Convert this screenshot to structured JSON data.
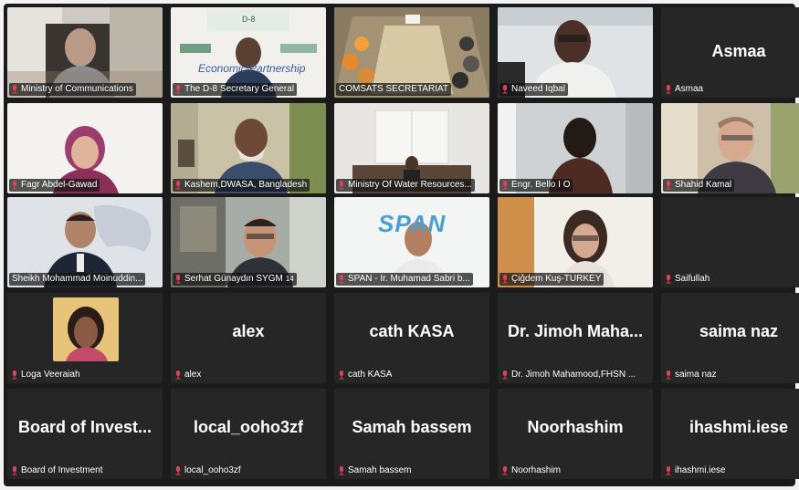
{
  "participants": [
    {
      "name": "Ministry of Communications",
      "display": "video"
    },
    {
      "name": "The D-8 Secretary General",
      "display": "video",
      "overlay": "Economic Partnership",
      "overlay_logo": "D-8"
    },
    {
      "name": "COMSATS SECRETARIAT",
      "display": "video",
      "active_speaker": true
    },
    {
      "name": "Naveed Iqbal",
      "display": "video"
    },
    {
      "name": "Asmaa",
      "display": "name_only",
      "big_label": "Asmaa"
    },
    {
      "name": "Fagr Abdel-Gawad",
      "display": "video"
    },
    {
      "name": "Kashem,DWASA, Bangladesh",
      "display": "video"
    },
    {
      "name": "Ministry Of Water Resources...",
      "display": "video"
    },
    {
      "name": "Engr. Bello I O",
      "display": "video"
    },
    {
      "name": "Shahid Kamal",
      "display": "video"
    },
    {
      "name": "Sheikh Mohammad Moinuddin...",
      "display": "video"
    },
    {
      "name": "Serhat Günaydın SYGM",
      "display": "video",
      "badge": "14"
    },
    {
      "name": "SPAN - Ir. Muhamad Sabri b...",
      "display": "video",
      "overlay": "SPAN"
    },
    {
      "name": "Çiğdem Kuş-TURKEY",
      "display": "video"
    },
    {
      "name": "Saifullah",
      "display": "name_only",
      "big_label": ""
    },
    {
      "name": "Loga Veeraiah",
      "display": "small_video"
    },
    {
      "name": "alex",
      "display": "name_only",
      "big_label": "alex"
    },
    {
      "name": "cath KASA",
      "display": "name_only",
      "big_label": "cath KASA"
    },
    {
      "name": "Dr. Jimoh Mahamood,FHSN ...",
      "display": "name_only",
      "big_label": "Dr. Jimoh Maha..."
    },
    {
      "name": "saima naz",
      "display": "name_only",
      "big_label": "saima naz"
    },
    {
      "name": "Board of Investment",
      "display": "name_only",
      "big_label": "Board of Invest..."
    },
    {
      "name": "local_ooho3zf",
      "display": "name_only",
      "big_label": "local_ooho3zf"
    },
    {
      "name": "Samah bassem",
      "display": "name_only",
      "big_label": "Samah bassem"
    },
    {
      "name": "Noorhashim",
      "display": "name_only",
      "big_label": "Noorhashim"
    },
    {
      "name": "ihashmi.iese",
      "display": "name_only",
      "big_label": "ihashmi.iese"
    }
  ],
  "colors": {
    "background": "#1b1b1b",
    "tile": "#262626",
    "active_speaker_border": "#e7d13b",
    "muted_mic": "#e0405a",
    "name_text": "#ffffff"
  },
  "icons": {
    "mic": "muted-mic-icon"
  }
}
